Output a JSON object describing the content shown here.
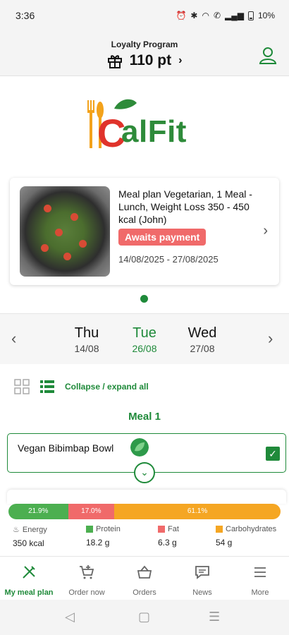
{
  "status_bar": {
    "time": "3:36",
    "battery": "10%"
  },
  "loyalty": {
    "title": "Loyalty Program",
    "points": "110 pt"
  },
  "logo": {
    "text": "alFit",
    "letter": "C"
  },
  "plan": {
    "title": "Meal plan Vegetarian, 1 Meal - Lunch, Weight Loss 350 - 450 kcal (John)",
    "status_badge": "Awaits payment",
    "dates": "14/08/2025 - 27/08/2025"
  },
  "days": [
    {
      "name": "Thu",
      "date": "14/08"
    },
    {
      "name": "Tue",
      "date": "26/08"
    },
    {
      "name": "Wed",
      "date": "27/08"
    }
  ],
  "toolbar": {
    "collapse_label": "Collapse / expand all"
  },
  "meal": {
    "heading": "Meal 1",
    "dish": "Vegan Bibimbap Bowl"
  },
  "macros": {
    "protein_pct": "21.9%",
    "fat_pct": "17.0%",
    "carbs_pct": "61.1%",
    "protein_share": 21.9,
    "fat_share": 17.0,
    "carbs_share": 61.1,
    "energy_label": "Energy",
    "energy_value": "350 kcal",
    "protein_label": "Protein",
    "protein_value": "18.2 g",
    "fat_label": "Fat",
    "fat_value": "6.3 g",
    "carbs_label": "Carbohydrates",
    "carbs_value": "54 g"
  },
  "colors": {
    "accent": "#1f8a3a",
    "protein": "#4caf50",
    "fat": "#f06a6a",
    "carbs": "#f5a623",
    "badge": "#f06a6a"
  },
  "nav": [
    {
      "label": "My meal plan",
      "icon": "cutlery-icon"
    },
    {
      "label": "Order now",
      "icon": "cart-plus-icon"
    },
    {
      "label": "Orders",
      "icon": "basket-icon"
    },
    {
      "label": "News",
      "icon": "chat-icon"
    },
    {
      "label": "More",
      "icon": "list-icon"
    }
  ]
}
